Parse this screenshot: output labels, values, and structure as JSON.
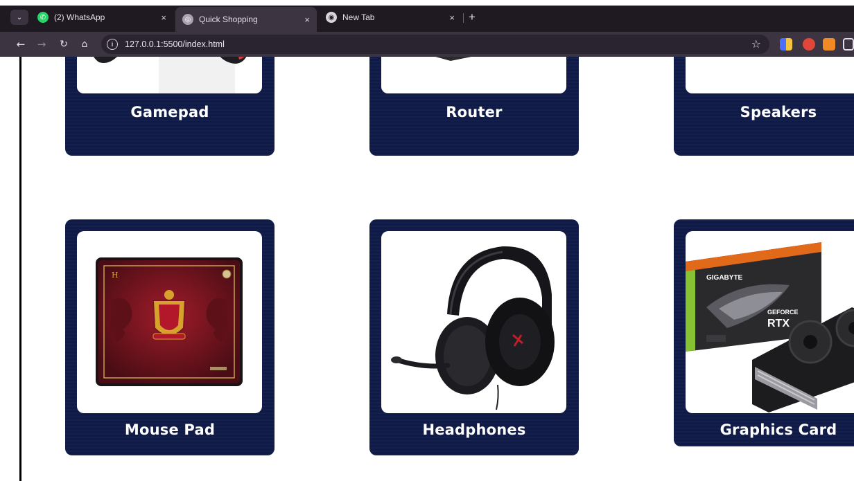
{
  "browser": {
    "tabs": [
      {
        "title": "(2) WhatsApp",
        "icon": "whatsapp-icon",
        "active": false
      },
      {
        "title": "Quick Shopping",
        "icon": "globe-icon",
        "active": true
      },
      {
        "title": "New Tab",
        "icon": "chrome-icon",
        "active": false
      }
    ],
    "close_glyph": "×",
    "new_tab_glyph": "+",
    "url": "127.0.0.1:5500/index.html"
  },
  "products": {
    "row1": [
      "Gamepad",
      "Router",
      "Speakers"
    ],
    "row2": [
      "Mouse Pad",
      "Headphones",
      "Graphics Card"
    ]
  },
  "colors": {
    "card_bg": "#0f1a47",
    "chrome_bg": "#1f1a22",
    "toolbar_bg": "#3d3442"
  }
}
